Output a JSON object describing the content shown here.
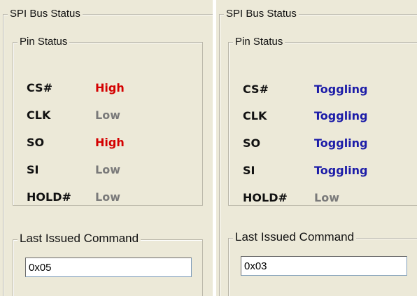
{
  "colors": {
    "high": "#d40000",
    "low": "#7a7a7a",
    "toggling": "#1c1ca8",
    "panel_bg": "#ece9d8"
  },
  "panels": [
    {
      "title": "SPI Bus Status",
      "pin_status_label": "Pin Status",
      "pins": [
        {
          "name": "CS#",
          "value": "High",
          "state": "high"
        },
        {
          "name": "CLK",
          "value": "Low",
          "state": "low"
        },
        {
          "name": "SO",
          "value": "High",
          "state": "high"
        },
        {
          "name": "SI",
          "value": "Low",
          "state": "low"
        },
        {
          "name": "HOLD#",
          "value": "Low",
          "state": "low"
        }
      ],
      "last_command_label": "Last Issued Command",
      "last_command_value": "0x05"
    },
    {
      "title": "SPI Bus Status",
      "pin_status_label": "Pin Status",
      "pins": [
        {
          "name": "CS#",
          "value": "Toggling",
          "state": "toggling"
        },
        {
          "name": "CLK",
          "value": "Toggling",
          "state": "toggling"
        },
        {
          "name": "SO",
          "value": "Toggling",
          "state": "toggling"
        },
        {
          "name": "SI",
          "value": "Toggling",
          "state": "toggling"
        },
        {
          "name": "HOLD#",
          "value": "Low",
          "state": "low"
        }
      ],
      "last_command_label": "Last Issued Command",
      "last_command_value": "0x03"
    }
  ]
}
